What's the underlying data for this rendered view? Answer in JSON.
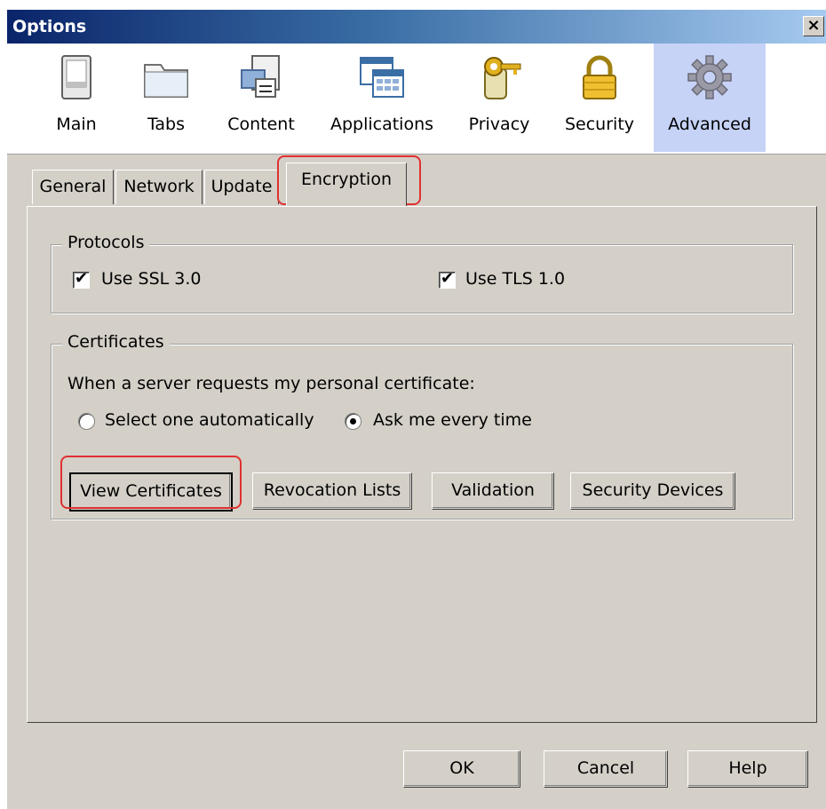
{
  "window": {
    "title": "Options",
    "close_glyph": "×"
  },
  "toolbar": [
    {
      "label": "Main",
      "icon": "switch-icon"
    },
    {
      "label": "Tabs",
      "icon": "folder-tab-icon"
    },
    {
      "label": "Content",
      "icon": "content-page-icon"
    },
    {
      "label": "Applications",
      "icon": "applications-window-icon"
    },
    {
      "label": "Privacy",
      "icon": "key-tag-icon"
    },
    {
      "label": "Security",
      "icon": "padlock-icon"
    },
    {
      "label": "Advanced",
      "icon": "gear-icon",
      "selected": true
    }
  ],
  "tabs": [
    {
      "label": "General"
    },
    {
      "label": "Network"
    },
    {
      "label": "Update"
    },
    {
      "label": "Encryption",
      "active": true
    }
  ],
  "protocols": {
    "title": "Protocols",
    "ssl": {
      "label": "Use SSL 3.0",
      "checked": true
    },
    "tls": {
      "label": "Use TLS 1.0",
      "checked": true
    }
  },
  "certificates": {
    "title": "Certificates",
    "prompt": "When a server requests my personal certificate:",
    "radio_auto": {
      "label": "Select one automatically",
      "selected": false
    },
    "radio_ask": {
      "label": "Ask me every time",
      "selected": true
    },
    "buttons": {
      "view": "View Certificates",
      "revocation": "Revocation Lists",
      "validation": "Validation",
      "devices": "Security Devices"
    }
  },
  "footer": {
    "ok": "OK",
    "cancel": "Cancel",
    "help": "Help"
  },
  "colors": {
    "title_gradient_start": "#0a246a",
    "highlight": "#e03030",
    "selected_tool": "#c6d3f7"
  },
  "check_glyph": "✔"
}
